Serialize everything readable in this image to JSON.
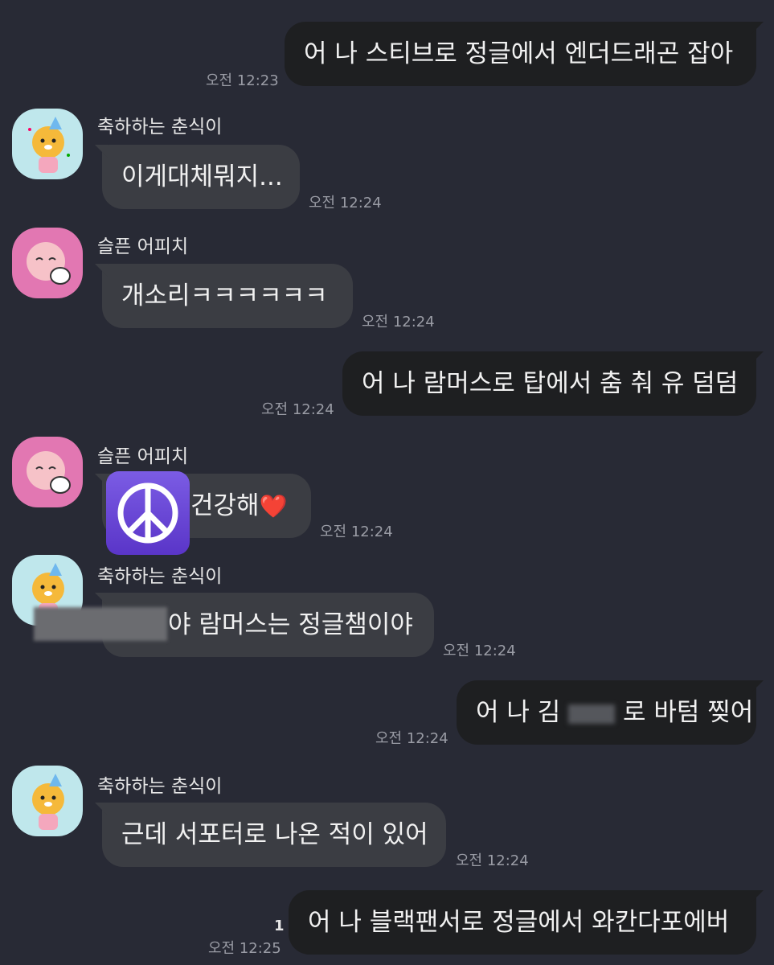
{
  "messages": [
    {
      "id": "m1",
      "direction": "outgoing",
      "text": "어 나 스티브로 정글에서 엔더드래곤 잡아",
      "time": "오전 12:23"
    },
    {
      "id": "m2",
      "direction": "incoming",
      "sender": "축하하는 춘식이",
      "text": "이게대체뭐지...",
      "time": "오전 12:24"
    },
    {
      "id": "m3",
      "direction": "incoming",
      "sender": "슬픈 어피치",
      "text": "개소리ㅋㅋㅋㅋㅋㅋ",
      "time": "오전 12:24"
    },
    {
      "id": "m4",
      "direction": "outgoing",
      "text": "어 나 람머스로 탑에서 춤 춰 유 덤덤",
      "time": "오전 12:24"
    },
    {
      "id": "m5",
      "direction": "incoming",
      "sender": "슬픈 어피치",
      "text": "건강해",
      "emoji": "❤️",
      "sticker": "☮",
      "time": "오전 12:24"
    },
    {
      "id": "m6",
      "direction": "incoming",
      "sender": "축하하는 춘식이",
      "text": "야 람머스는 정글챔이야",
      "time": "오전 12:24"
    },
    {
      "id": "m7",
      "direction": "outgoing",
      "text_before": "어 나 김",
      "text_after": "로 바텀 찢어",
      "time": "오전 12:24"
    },
    {
      "id": "m8",
      "direction": "incoming",
      "sender": "축하하는 춘식이",
      "text": "근데 서포터로 나온 적이 있어",
      "time": "오전 12:24"
    },
    {
      "id": "m9",
      "direction": "outgoing",
      "text": "어 나 블랙팬서로 정글에서 와칸다포에버",
      "time": "오전 12:25",
      "unread": "1"
    }
  ],
  "colors": {
    "background": "#282a35",
    "outgoing_bubble": "#1e1f21",
    "incoming_bubble": "#3b3d43",
    "time_text": "#9a9ca5"
  },
  "icons": [
    "ryan-chunsik-avatar-icon",
    "apeach-avatar-icon",
    "peace-symbol-icon",
    "heart-emoji-icon"
  ]
}
